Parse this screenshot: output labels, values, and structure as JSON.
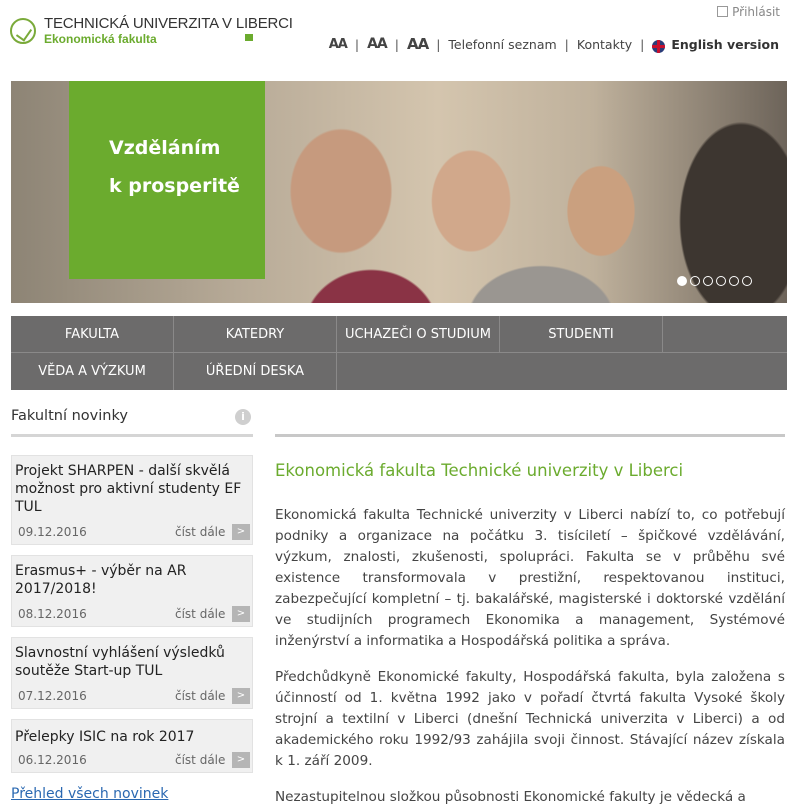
{
  "header": {
    "logo_line1": "TECHNICKÁ UNIVERZITA V LIBERCI",
    "logo_line2": "Ekonomická fakulta",
    "login": "Přihlásit",
    "font_small": "AA",
    "font_medium": "AA",
    "font_large": "AA",
    "phonebook": "Telefonní seznam",
    "contacts": "Kontakty",
    "english": "English version"
  },
  "hero": {
    "line1": "Vzděláním",
    "line2": "k prosperitě",
    "slides": 6,
    "active_slide": 1
  },
  "main_nav": [
    "FAKULTA",
    "KATEDRY",
    "UCHAZEČI O STUDIUM",
    "STUDENTI",
    "VĚDA A VÝZKUM",
    "ÚŘEDNÍ DESKA"
  ],
  "news": {
    "title": "Fakultní novinky",
    "read_more": "číst dále",
    "items": [
      {
        "title": "Projekt SHARPEN - další skvělá možnost pro aktivní studenty EF TUL",
        "date": "09.12.2016"
      },
      {
        "title": "Erasmus+ - výběr na AR 2017/2018!",
        "date": "08.12.2016"
      },
      {
        "title": "Slavnostní vyhlášení výsledků soutěže Start-up TUL",
        "date": "07.12.2016"
      },
      {
        "title": "Přelepky ISIC na rok 2017",
        "date": "06.12.2016"
      }
    ],
    "all_link": "Přehled všech novinek"
  },
  "content": {
    "title": "Ekonomická fakulta Technické univerzity v Liberci",
    "p1": "Ekonomická fakulta Technické univerzity v Liberci nabízí to, co potřebují podniky a organizace na počátku 3. tisíciletí – špičkové vzdělávání, výzkum, znalosti, zkušenosti, spolupráci. Fakulta se v průběhu své existence transformovala v prestižní, respektovanou instituci, zabezpečující kompletní – tj. bakalářské, magisterské i doktorské vzdělání ve studijních programech Ekonomika a management, Systémové inženýrství a informatika a Hospodářská politika a správa.",
    "p2": "Předchůdkyně Ekonomické fakulty, Hospodářská fakulta, byla založena s účinností od 1. května 1992 jako v pořadí čtvrtá fakulta Vysoké školy strojní a textilní v Liberci (dnešní Technická univerzita v Liberci) a od akademického roku 1992/93 zahájila svoji činnost. Stávající název získala k 1. září 2009.",
    "p3": "Nezastupitelnou složkou působnosti Ekonomické fakulty je vědecká a"
  },
  "colors": {
    "brand_green": "#6bab2e",
    "nav_gray": "#6c6b6b",
    "link_blue": "#2a68b1"
  }
}
